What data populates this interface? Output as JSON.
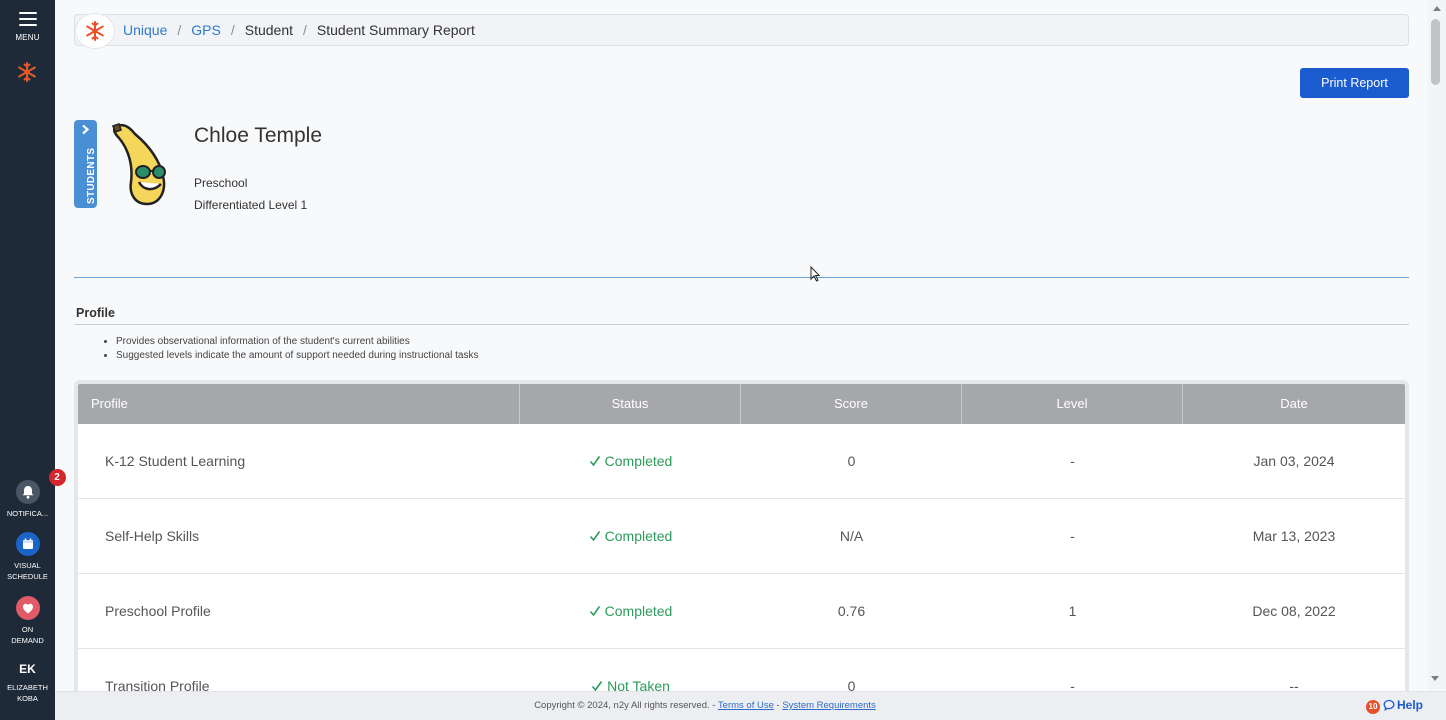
{
  "rail": {
    "menu_label": "MENU",
    "notifications": {
      "label": "NOTIFICA...",
      "count": "2"
    },
    "visual_schedule": {
      "label_line1": "VISUAL",
      "label_line2": "SCHEDULE"
    },
    "on_demand": {
      "label_line1": "ON",
      "label_line2": "DEMAND"
    },
    "user": {
      "initials": "EK",
      "name_line1": "ELIZABETH",
      "name_line2": "KOBA"
    }
  },
  "breadcrumb": {
    "items": [
      "Unique",
      "GPS",
      "Student",
      "Student Summary Report"
    ],
    "separator": "/"
  },
  "toolbar": {
    "print_label": "Print Report"
  },
  "student": {
    "tab_label": "STUDENTS",
    "name": "Chloe Temple",
    "grade": "Preschool",
    "level": "Differentiated Level 1"
  },
  "profile": {
    "title": "Profile",
    "bullets": [
      "Provides observational information of the student's current abilities",
      "Suggested levels indicate the amount of support needed during instructional tasks"
    ],
    "columns": [
      "Profile",
      "Status",
      "Score",
      "Level",
      "Date"
    ],
    "rows": [
      {
        "profile": "K-12 Student Learning",
        "status": "Completed",
        "score": "0",
        "level": "-",
        "date": "Jan 03, 2024"
      },
      {
        "profile": "Self-Help Skills",
        "status": "Completed",
        "score": "N/A",
        "level": "-",
        "date": "Mar 13, 2023"
      },
      {
        "profile": "Preschool Profile",
        "status": "Completed",
        "score": "0.76",
        "level": "1",
        "date": "Dec 08, 2022"
      },
      {
        "profile": "Transition Profile",
        "status": "Not Taken",
        "score": "0",
        "level": "-",
        "date": "--"
      }
    ]
  },
  "footer": {
    "copyright": "Copyright © 2024, n2y All rights reserved. -",
    "terms": "Terms of Use",
    "dash": "-",
    "sysreq": "System Requirements",
    "help_count": "10",
    "help_label": "Help"
  },
  "colors": {
    "rail": "#1f2a38",
    "accent": "#1a5bd0",
    "link": "#2e7bc8",
    "completed": "#2d9a5a",
    "header": "#a5a7ab"
  }
}
